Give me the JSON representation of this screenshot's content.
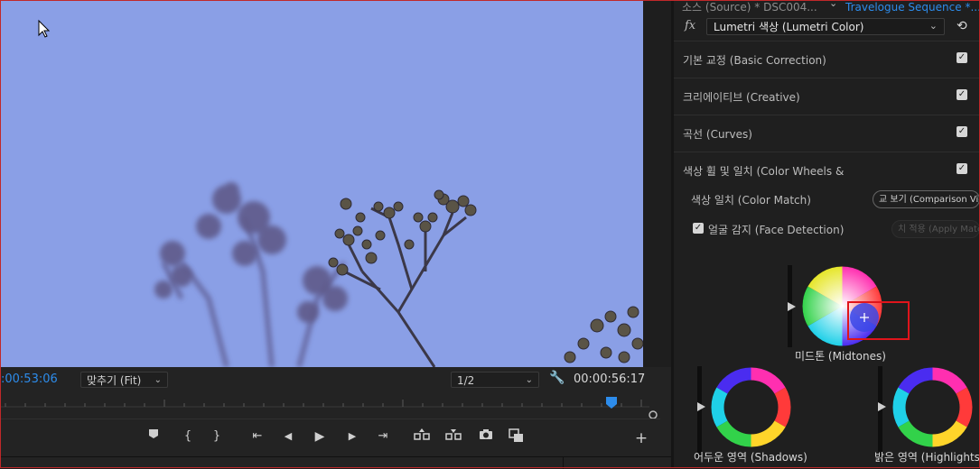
{
  "monitor": {
    "current_time": ":00:53:06",
    "zoom_label": "맞추기 (Fit)",
    "resolution_label": "1/2",
    "duration": "00:00:56:17",
    "controls": {
      "add_marker": "⬤",
      "mark_in": "{",
      "mark_out": "}",
      "go_to_in": "⇤",
      "step_back": "◀",
      "play": "▶",
      "step_forward": "▶",
      "go_to_out": "⇥",
      "lift": "⇧",
      "extract": "⇩",
      "export_frame": "📷",
      "comparison": "◧",
      "add_button": "+"
    }
  },
  "panel": {
    "source_label": "소스 (Source) * DSC004...",
    "sequence_label": "Travelogue Sequence *...",
    "fx_label": "fx",
    "effect_name": "Lumetri 색상 (Lumetri Color)",
    "sections": [
      {
        "label": "기본 교정 (Basic Correction)",
        "checked": true
      },
      {
        "label": "크리에이티브 (Creative)",
        "checked": true
      },
      {
        "label": "곡선 (Curves)",
        "checked": true
      },
      {
        "label": "색상 휠 및 일치 (Color Wheels &",
        "checked": true
      }
    ],
    "color_match_label": "색상 일치 (Color Match)",
    "comparison_view_label": "교 보기 (Comparison View)",
    "face_detection_label": "얼굴 감지 (Face Detection)",
    "face_detection_checked": true,
    "apply_match_label": "치 적용 (Apply Match)",
    "wheels": {
      "midtones": "미드톤 (Midtones)",
      "shadows": "어두운 영역 (Shadows)",
      "highlights": "밝은 영역 (Highlights)"
    }
  },
  "colors": {
    "accent_blue": "#2d8ceb",
    "highlight_red": "#e0141b",
    "sky": "#8a9fe6"
  }
}
